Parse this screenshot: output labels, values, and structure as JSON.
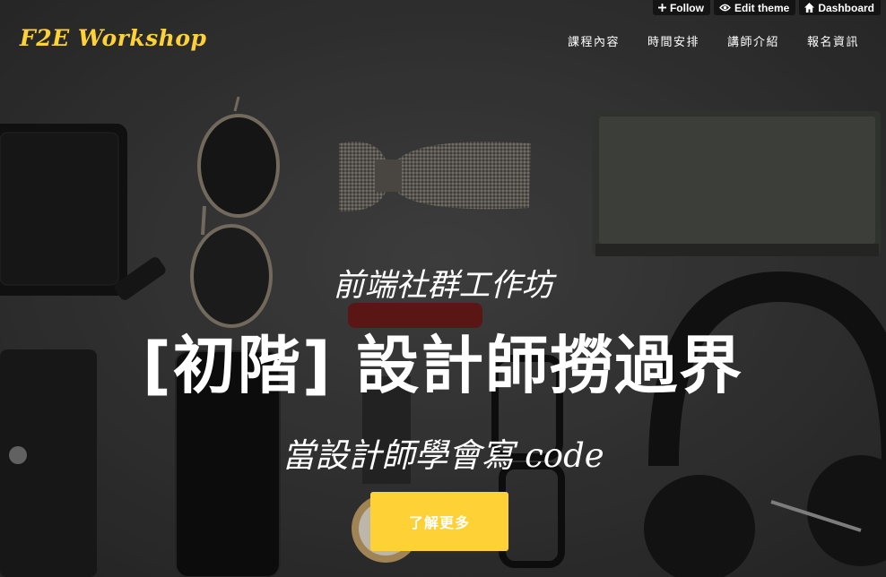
{
  "toolbar": {
    "follow": {
      "label": "Follow",
      "icon": "plus-icon"
    },
    "edit_theme": {
      "label": "Edit theme",
      "icon": "eye-icon"
    },
    "dashboard": {
      "label": "Dashboard",
      "icon": "home-icon"
    }
  },
  "brand": {
    "name": "F2E Workshop",
    "color": "#fed136"
  },
  "nav": {
    "items": [
      {
        "label": "課程內容"
      },
      {
        "label": "時間安排"
      },
      {
        "label": "講師介紹"
      },
      {
        "label": "報名資訊"
      }
    ]
  },
  "hero": {
    "subheading": "前端社群工作坊",
    "heading": "[初階] 設計師撈過界",
    "tagline": "當設計師學會寫 code",
    "cta_label": "了解更多",
    "cta_color": "#fed136"
  }
}
